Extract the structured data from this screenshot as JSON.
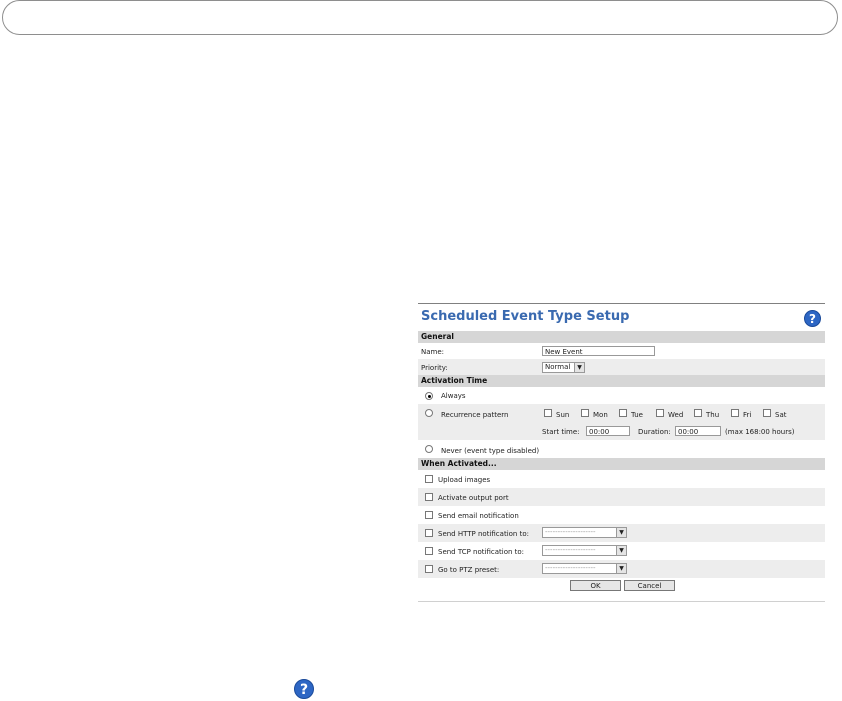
{
  "panel": {
    "title": "Scheduled Event Type Setup",
    "help_icon": "question-mark-icon",
    "general": {
      "heading": "General",
      "name_label": "Name:",
      "name_value": "New Event",
      "priority_label": "Priority:",
      "priority_value": "Normal"
    },
    "activation": {
      "heading": "Activation Time",
      "always_label": "Always",
      "recurrence_label": "Recurrence pattern",
      "days": [
        "Sun",
        "Mon",
        "Tue",
        "Wed",
        "Thu",
        "Fri",
        "Sat"
      ],
      "start_label": "Start time:",
      "start_value": "00:00",
      "duration_label": "Duration:",
      "duration_value": "00:00",
      "max_note": "(max 168:00 hours)",
      "never_label": "Never (event type disabled)",
      "selected": "Always"
    },
    "when": {
      "heading": "When Activated...",
      "upload_label": "Upload images",
      "output_label": "Activate output port",
      "email_label": "Send email notification",
      "http_label": "Send HTTP notification to:",
      "tcp_label": "Send TCP notification to:",
      "ptz_label": "Go to PTZ preset:",
      "dropdown_placeholder": "--------------------"
    },
    "ok_label": "OK",
    "cancel_label": "Cancel"
  },
  "colors": {
    "title": "#3a6ab0",
    "section_bg": "#d6d6d6",
    "help": "#2d66c4"
  }
}
